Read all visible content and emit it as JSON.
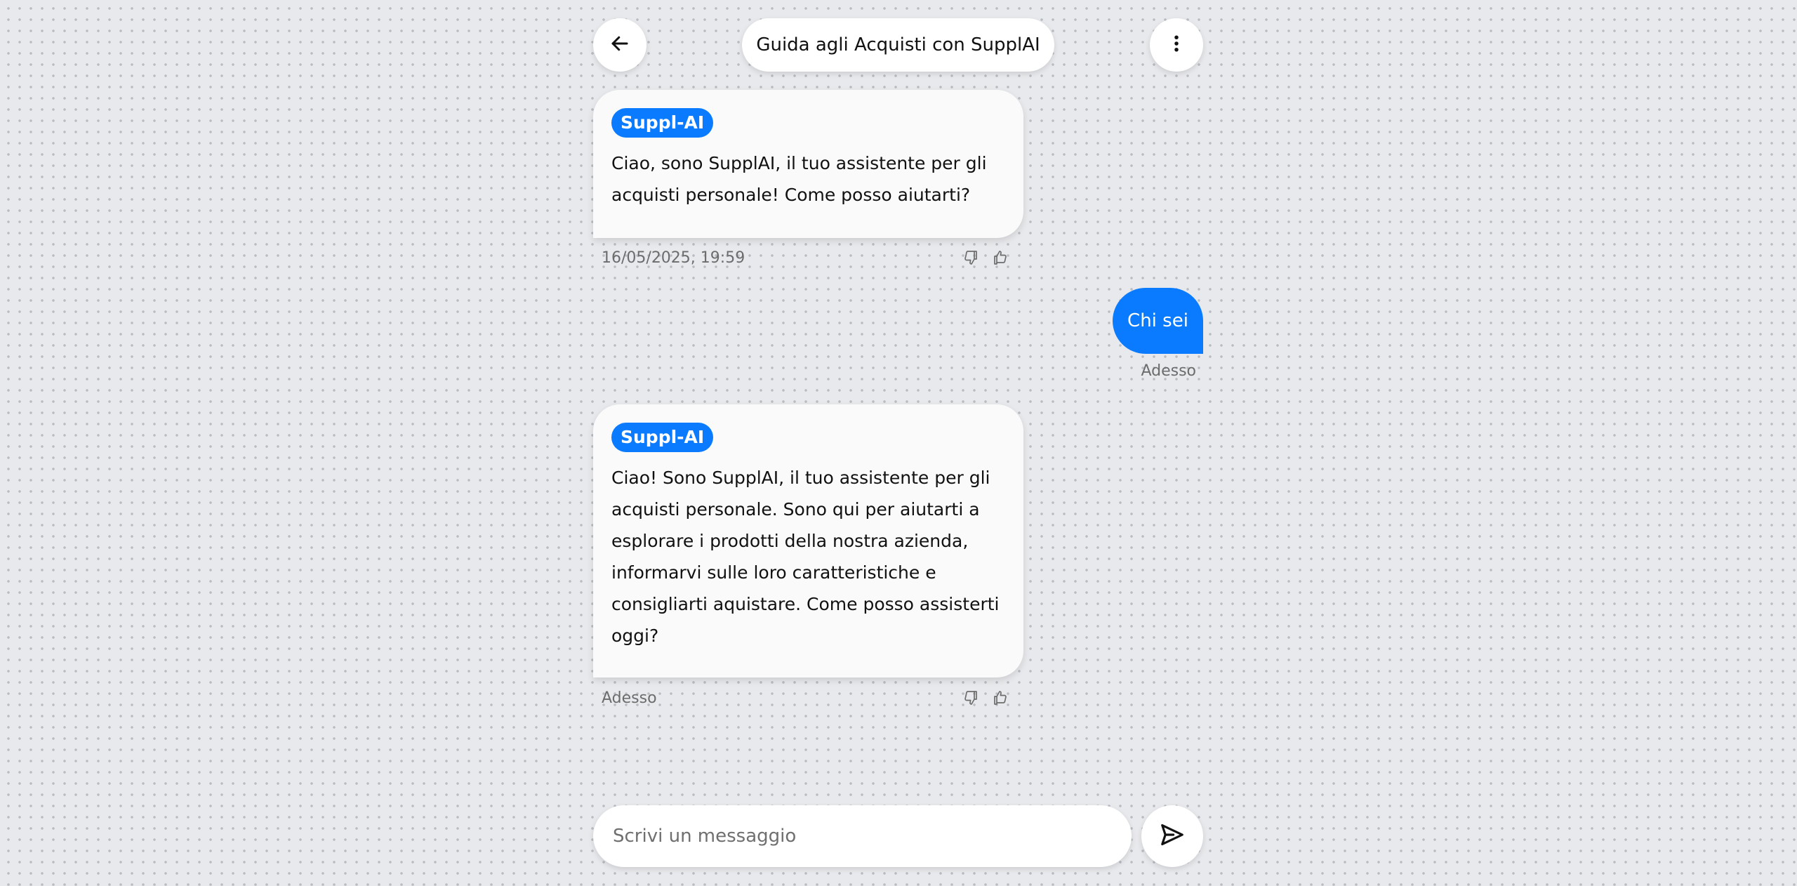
{
  "header": {
    "title": "Guida agli Acquisti con SupplAI",
    "back_icon": "arrow-left-icon",
    "menu_icon": "more-vertical-icon"
  },
  "messages": [
    {
      "role": "assistant",
      "sender": "Suppl-AI",
      "text": "Ciao, sono SupplAI, il tuo assistente per gli acquisti personale! Come posso aiutarti?",
      "timestamp": "16/05/2025, 19:59"
    },
    {
      "role": "user",
      "text": "Chi sei",
      "timestamp": "Adesso"
    },
    {
      "role": "assistant",
      "sender": "Suppl-AI",
      "text": "Ciao! Sono SupplAI, il tuo assistente per gli acquisti personale. Sono qui per aiutarti a esplorare i prodotti della nostra azienda, informarvi sulle loro caratteristiche e consigliarti aquistare. Come posso assisterti oggi?",
      "timestamp": "Adesso"
    }
  ],
  "composer": {
    "placeholder": "Scrivi un messaggio",
    "value": "",
    "send_icon": "send-icon"
  },
  "colors": {
    "accent": "#0a7bff",
    "background": "#e8e9ec",
    "bubble": "#fafafa"
  }
}
